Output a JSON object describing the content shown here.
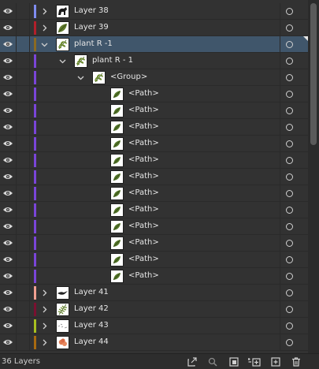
{
  "layer_count_label": "36 Layers",
  "rows": [
    {
      "name": "Layer 38",
      "color": "#7f8cf0",
      "chevron": "right",
      "level": 0,
      "thumb": "horse-icon",
      "selected": false
    },
    {
      "name": "Layer 39",
      "color": "#b21f2a",
      "chevron": "right",
      "level": 0,
      "thumb": "leaf-icon",
      "selected": false
    },
    {
      "name": "plant R -1",
      "color": "#8a6a22",
      "chevron": "down",
      "level": 0,
      "thumb": "plant-icon",
      "selected": true
    },
    {
      "name": "plant R - 1",
      "color": "#7a45d8",
      "chevron": "down",
      "level": 1,
      "thumb": "plant-icon",
      "selected": false
    },
    {
      "name": "<Group>",
      "color": "#7a45d8",
      "chevron": "down",
      "level": 2,
      "thumb": "plant-icon",
      "selected": false
    },
    {
      "name": "<Path>",
      "color": "#7a45d8",
      "chevron": "none",
      "level": 3,
      "thumb": "leaf-path-icon",
      "selected": false
    },
    {
      "name": "<Path>",
      "color": "#7a45d8",
      "chevron": "none",
      "level": 3,
      "thumb": "leaf-path-icon",
      "selected": false
    },
    {
      "name": "<Path>",
      "color": "#7a45d8",
      "chevron": "none",
      "level": 3,
      "thumb": "leaf-path-icon",
      "selected": false
    },
    {
      "name": "<Path>",
      "color": "#7a45d8",
      "chevron": "none",
      "level": 3,
      "thumb": "leaf-path-icon",
      "selected": false
    },
    {
      "name": "<Path>",
      "color": "#7a45d8",
      "chevron": "none",
      "level": 3,
      "thumb": "leaf-path-icon",
      "selected": false
    },
    {
      "name": "<Path>",
      "color": "#7a45d8",
      "chevron": "none",
      "level": 3,
      "thumb": "leaf-path-icon",
      "selected": false
    },
    {
      "name": "<Path>",
      "color": "#7a45d8",
      "chevron": "none",
      "level": 3,
      "thumb": "leaf-path-icon",
      "selected": false
    },
    {
      "name": "<Path>",
      "color": "#7a45d8",
      "chevron": "none",
      "level": 3,
      "thumb": "leaf-path-icon",
      "selected": false
    },
    {
      "name": "<Path>",
      "color": "#7a45d8",
      "chevron": "none",
      "level": 3,
      "thumb": "leaf-path-icon",
      "selected": false
    },
    {
      "name": "<Path>",
      "color": "#7a45d8",
      "chevron": "none",
      "level": 3,
      "thumb": "leaf-path-icon",
      "selected": false
    },
    {
      "name": "<Path>",
      "color": "#7a45d8",
      "chevron": "none",
      "level": 3,
      "thumb": "leaf-path-icon",
      "selected": false
    },
    {
      "name": "<Path>",
      "color": "#7a45d8",
      "chevron": "none",
      "level": 3,
      "thumb": "leaf-path-icon",
      "selected": false
    },
    {
      "name": "Layer 41",
      "color": "#f0a090",
      "chevron": "right",
      "level": 0,
      "thumb": "bird-icon",
      "selected": false
    },
    {
      "name": "Layer 42",
      "color": "#7a1030",
      "chevron": "right",
      "level": 0,
      "thumb": "fern-icon",
      "selected": false
    },
    {
      "name": "Layer 43",
      "color": "#a8c020",
      "chevron": "right",
      "level": 0,
      "thumb": "sketch-icon",
      "selected": false
    },
    {
      "name": "Layer 44",
      "color": "#a86a10",
      "chevron": "right",
      "level": 0,
      "thumb": "flower-icon",
      "selected": false
    }
  ],
  "footer_icons": [
    "export-icon",
    "search-icon",
    "clipping-mask-icon",
    "new-sublayer-icon",
    "new-layer-icon",
    "trash-icon"
  ]
}
